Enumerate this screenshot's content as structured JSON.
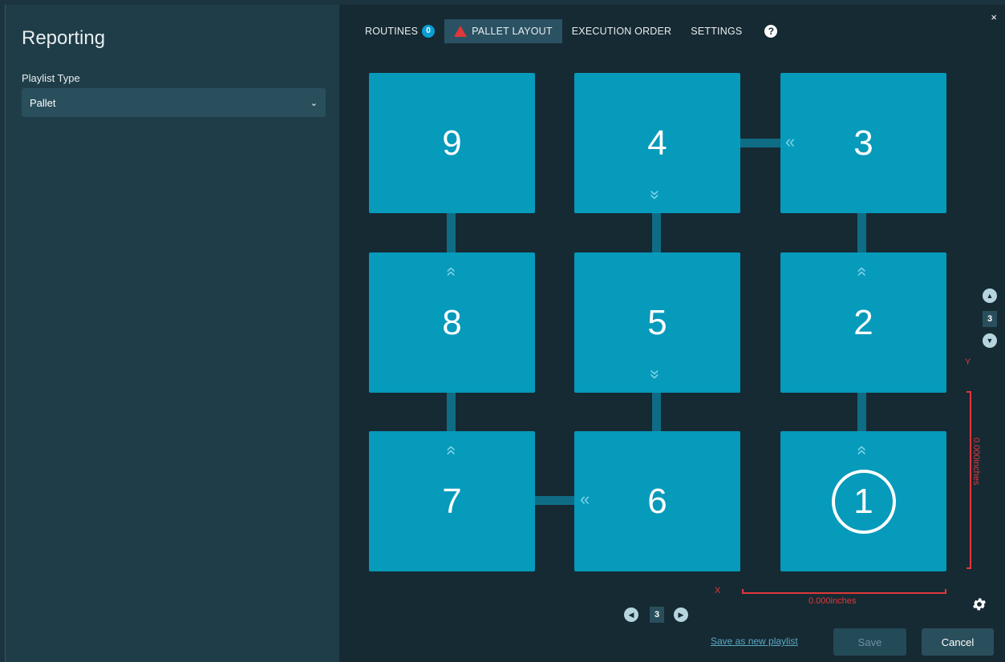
{
  "left": {
    "title": "Reporting",
    "playlist_label": "Playlist Type",
    "playlist_value": "Pallet"
  },
  "nav": {
    "routines": "ROUTINES",
    "routines_count": "0",
    "pallet_layout": "PALLET LAYOUT",
    "execution_order": "EXECUTION ORDER",
    "settings": "SETTINGS",
    "help": "?",
    "close": "×"
  },
  "tiles": [
    "9",
    "4",
    "3",
    "8",
    "5",
    "2",
    "7",
    "6",
    "1"
  ],
  "y_stepper_value": "3",
  "x_stepper_value": "3",
  "axis": {
    "y_label": "Y",
    "x_label": "X",
    "y_value": "0.000inches",
    "x_value": "0.000inches"
  },
  "footer": {
    "save_as_new": "Save as new playlist",
    "save": "Save",
    "cancel": "Cancel"
  },
  "colors": {
    "tile": "#069abb",
    "connector": "#0f6c85",
    "accent_red": "#e0383a"
  }
}
